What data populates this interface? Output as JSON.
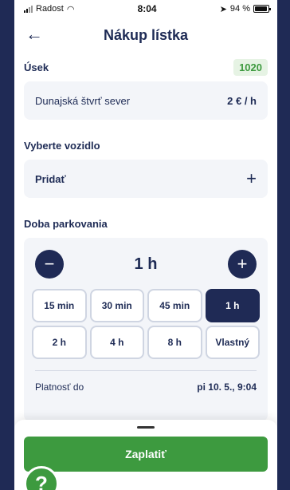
{
  "status_bar": {
    "carrier": "Radost",
    "time": "8:04",
    "battery": "94 %"
  },
  "header": {
    "back_icon": "←",
    "title": "Nákup lístka"
  },
  "section": {
    "label": "Úsek",
    "code": "1020",
    "name": "Dunajská štvrť sever",
    "price": "2 € / h"
  },
  "vehicle": {
    "label": "Vyberte vozidlo",
    "add_label": "Pridať",
    "plus": "+"
  },
  "duration": {
    "label": "Doba parkovania",
    "minus": "−",
    "plus": "+",
    "value": "1 h",
    "options": [
      "15 min",
      "30 min",
      "45 min",
      "1 h",
      "2 h",
      "4 h",
      "8 h",
      "Vlastný"
    ],
    "selected": "1 h"
  },
  "validity": {
    "label": "Platnosť do",
    "value": "pi 10. 5., 9:04"
  },
  "pay": {
    "label": "Zaplatiť"
  },
  "help": {
    "glyph": "?"
  },
  "colors": {
    "primary": "#1f2a55",
    "accent": "#3d9a3f"
  }
}
